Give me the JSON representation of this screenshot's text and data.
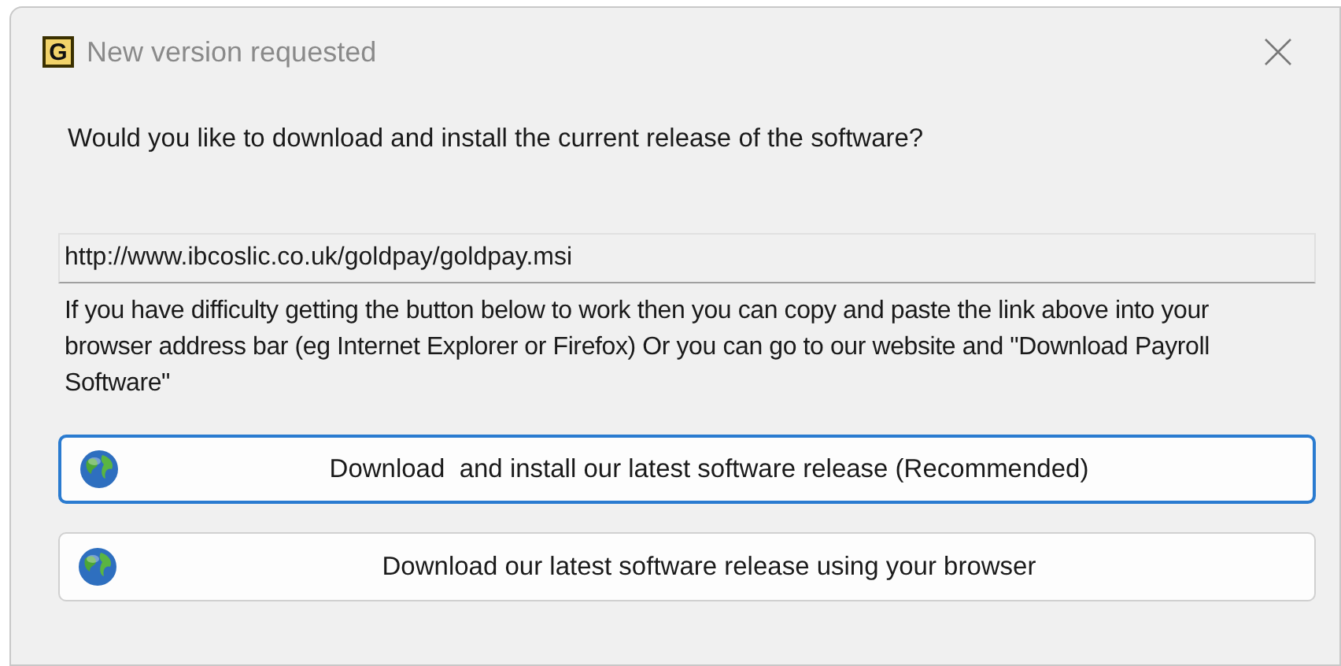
{
  "window": {
    "title": "New version requested",
    "app_icon_letter": "G"
  },
  "question": "Would you like to download and install the current release of the software?",
  "link_field": {
    "value": "http://www.ibcoslic.co.uk/goldpay/goldpay.msi"
  },
  "help_text": "If you have difficulty getting the button below to work then you can copy and paste the link above into your browser address bar (eg Internet Explorer or Firefox) Or you can go to our website and \"Download Payroll Software\"",
  "buttons": [
    {
      "label": "Download  and install our latest software release (Recommended)",
      "focused": true
    },
    {
      "label": "Download our latest software release using your browser",
      "focused": false
    }
  ]
}
